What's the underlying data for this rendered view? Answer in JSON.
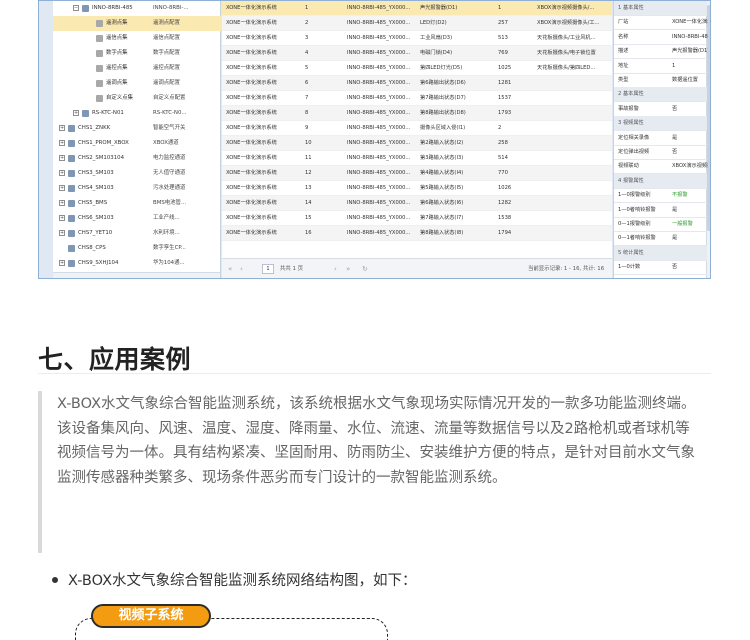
{
  "tree": {
    "rows": [
      {
        "label": "INNO-8RBI-485",
        "value": "INNO-8RBI-...",
        "indent": 2,
        "expander": "−",
        "icon": "device"
      },
      {
        "label": "遥测点集",
        "value": "遥测点配置",
        "indent": 3,
        "icon": "grid",
        "selected": true
      },
      {
        "label": "遥信点集",
        "value": "遥信点配置",
        "indent": 3,
        "icon": "grid"
      },
      {
        "label": "数字点集",
        "value": "数字点配置",
        "indent": 3,
        "icon": "grid"
      },
      {
        "label": "遥控点集",
        "value": "遥控点配置",
        "indent": 3,
        "icon": "grid"
      },
      {
        "label": "遥调点集",
        "value": "遥调点配置",
        "indent": 3,
        "icon": "grid"
      },
      {
        "label": "自定义点集",
        "value": "自定义点配置",
        "indent": 3,
        "icon": "grid"
      },
      {
        "label": "RS-KTC-N01",
        "value": "RS-KTC-N0...",
        "indent": 2,
        "expander": "+",
        "icon": "device"
      },
      {
        "label": "CHS1_ZNKK",
        "value": "智能空气开关",
        "indent": 1,
        "expander": "+",
        "icon": "channel"
      },
      {
        "label": "CHS1_PROM_XBOX",
        "value": "XBOX通道",
        "indent": 1,
        "expander": "+",
        "icon": "channel"
      },
      {
        "label": "CHS2_SM103104",
        "value": "电力监控通道",
        "indent": 1,
        "expander": "+",
        "icon": "channel"
      },
      {
        "label": "CHS3_SM103",
        "value": "无人值守通道",
        "indent": 1,
        "expander": "+",
        "icon": "channel"
      },
      {
        "label": "CHS4_SM103",
        "value": "污水处理通道",
        "indent": 1,
        "expander": "+",
        "icon": "channel"
      },
      {
        "label": "CHS5_BMS",
        "value": "BMS电池管...",
        "indent": 1,
        "expander": "+",
        "icon": "channel"
      },
      {
        "label": "CHS6_SM103",
        "value": "工业产线...",
        "indent": 1,
        "expander": "+",
        "icon": "channel"
      },
      {
        "label": "CHS7_YET10",
        "value": "水利环境...",
        "indent": 1,
        "expander": "+",
        "icon": "channel"
      },
      {
        "label": "CHS8_CPS",
        "value": "数字孪生CP...",
        "indent": 1,
        "icon": "channel"
      },
      {
        "label": "CHS9_SXHJ104",
        "value": "华为104通...",
        "indent": 1,
        "expander": "+",
        "icon": "channel"
      }
    ]
  },
  "grid": {
    "rows": [
      {
        "c1": "XONE一体化演示系统",
        "c2": "1",
        "c3": "INNO-8RBI-485_YX000...",
        "c4": "声光报警器(D1)",
        "c5": "1",
        "c6": "XBOX演示视频摄像头/...",
        "selected": true
      },
      {
        "c1": "XONE一体化演示系统",
        "c2": "2",
        "c3": "INNO-8RBI-485_YX000...",
        "c4": "LED灯(D2)",
        "c5": "257",
        "c6": "XBOX演示视频摄像头/工..."
      },
      {
        "c1": "XONE一体化演示系统",
        "c2": "3",
        "c3": "INNO-8RBI-485_YX000...",
        "c4": "工业风扇(D3)",
        "c5": "513",
        "c6": "天花板摄像头/工业风机..."
      },
      {
        "c1": "XONE一体化演示系统",
        "c2": "4",
        "c3": "INNO-8RBI-485_YX000...",
        "c4": "电磁门锁(D4)",
        "c5": "769",
        "c6": "天花板摄像头/电子锁位置"
      },
      {
        "c1": "XONE一体化演示系统",
        "c2": "5",
        "c3": "INNO-8RBI-485_YX000...",
        "c4": "第四LED灯光(D5)",
        "c5": "1025",
        "c6": "天花板摄像头/第四LED..."
      },
      {
        "c1": "XONE一体化演示系统",
        "c2": "6",
        "c3": "INNO-8RBI-485_YX000...",
        "c4": "第6路输出状态(D6)",
        "c5": "1281",
        "c6": ""
      },
      {
        "c1": "XONE一体化演示系统",
        "c2": "7",
        "c3": "INNO-8RBI-485_YX000...",
        "c4": "第7路输出状态(D7)",
        "c5": "1537",
        "c6": ""
      },
      {
        "c1": "XONE一体化演示系统",
        "c2": "8",
        "c3": "INNO-8RBI-485_YX000...",
        "c4": "第8路输出状态(D8)",
        "c5": "1793",
        "c6": ""
      },
      {
        "c1": "XONE一体化演示系统",
        "c2": "9",
        "c3": "INNO-8RBI-485_YX000...",
        "c4": "摄像头区域入侵(I1)",
        "c5": "2",
        "c6": ""
      },
      {
        "c1": "XONE一体化演示系统",
        "c2": "10",
        "c3": "INNO-8RBI-485_YX000...",
        "c4": "第2路输入状态(I2)",
        "c5": "258",
        "c6": ""
      },
      {
        "c1": "XONE一体化演示系统",
        "c2": "11",
        "c3": "INNO-8RBI-485_YX000...",
        "c4": "第3路输入状态(I3)",
        "c5": "514",
        "c6": ""
      },
      {
        "c1": "XONE一体化演示系统",
        "c2": "12",
        "c3": "INNO-8RBI-485_YX000...",
        "c4": "第4路输入状态(I4)",
        "c5": "770",
        "c6": ""
      },
      {
        "c1": "XONE一体化演示系统",
        "c2": "13",
        "c3": "INNO-8RBI-485_YX000...",
        "c4": "第5路输入状态(I5)",
        "c5": "1026",
        "c6": ""
      },
      {
        "c1": "XONE一体化演示系统",
        "c2": "14",
        "c3": "INNO-8RBI-485_YX000...",
        "c4": "第6路输入状态(I6)",
        "c5": "1282",
        "c6": ""
      },
      {
        "c1": "XONE一体化演示系统",
        "c2": "15",
        "c3": "INNO-8RBI-485_YX000...",
        "c4": "第7路输入状态(I7)",
        "c5": "1538",
        "c6": ""
      },
      {
        "c1": "XONE一体化演示系统",
        "c2": "16",
        "c3": "INNO-8RBI-485_YX000...",
        "c4": "第8路输入状态(I8)",
        "c5": "1794",
        "c6": ""
      }
    ],
    "pager": {
      "first": "«",
      "prev": "‹",
      "page": "1",
      "total": "共共 1 页",
      "next": "›",
      "last": "»",
      "refresh": "↻",
      "summary": "当前显示记录: 1 - 16, 共计: 16"
    }
  },
  "props": {
    "rows": [
      {
        "k": "1 基本属性",
        "head": true
      },
      {
        "k": "厂站",
        "v": "XONE一体化演示系统"
      },
      {
        "k": "名称",
        "v": "INNO-8RBI-485_YX0..."
      },
      {
        "k": "描述",
        "v": "声光报警器(D1)"
      },
      {
        "k": "地址",
        "v": "1"
      },
      {
        "k": "类型",
        "v": "数据遥位置"
      },
      {
        "k": "2 基本属性",
        "head": true
      },
      {
        "k": "事故报警",
        "v": "否"
      },
      {
        "k": "3 视频属性",
        "head": true
      },
      {
        "k": "定位相关录像",
        "v": "是"
      },
      {
        "k": "定位弹出视频",
        "v": "否"
      },
      {
        "k": "视频联动",
        "v": "XBOX演示视频摄像头/..."
      },
      {
        "k": "4 报警属性",
        "head": true
      },
      {
        "k": "1—0报警级别",
        "v": "不报警",
        "green": true
      },
      {
        "k": "1—0者响铃报警",
        "v": "是"
      },
      {
        "k": "0—1报警级别",
        "v": "一般报警",
        "green": true
      },
      {
        "k": "0—1者响铃报警",
        "v": "是"
      },
      {
        "k": "5 统计属性",
        "head": true
      },
      {
        "k": "1—0计数",
        "v": "否"
      }
    ]
  },
  "article": {
    "heading": "七、应用案例",
    "paragraph": "X-BOX水文气象综合智能监测系统，该系统根据水文气象现场实际情况开发的一款多功能监测终端。该设备集风向、风速、温度、湿度、降雨量、水位、流速、流量等数据信号以及2路枪机或者球机等视频信号为一体。具有结构紧凑、坚固耐用、防雨防尘、安装维护方便的特点，是针对目前水文气象监测传感器种类繁多、现场条件恶劣而专门设计的一款智能监测系统。",
    "bullet": "X-BOX水文气象综合智能监测系统网络结构图，如下：",
    "diagram_tag": "视频子系统"
  },
  "colors": {
    "selected_row": "#fbe9b2",
    "accent_tag": "#f39c12",
    "frame_border": "#8fb0d6"
  }
}
